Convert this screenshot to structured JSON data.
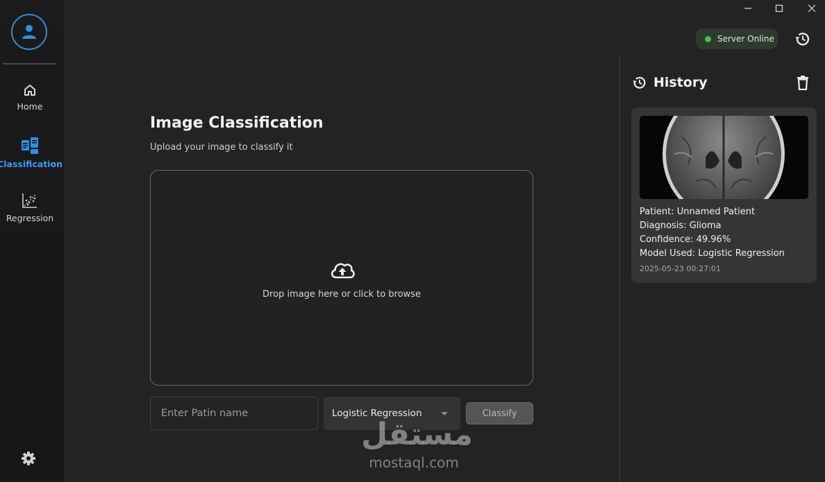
{
  "sidebar": {
    "items": [
      {
        "label": "Home",
        "icon": "home-icon"
      },
      {
        "label": "Classification",
        "icon": "classification-icon"
      },
      {
        "label": "Regression",
        "icon": "regression-icon"
      }
    ],
    "active": "Classification"
  },
  "status": {
    "label": "Server Online",
    "color": "#46c24c"
  },
  "main": {
    "title": "Image Classification",
    "subtitle": "Upload your image to classify it",
    "dropzone_text": "Drop image here or click to browse",
    "name_placeholder": "Enter Patin name",
    "model_selected": "Logistic Regression",
    "classify_label": "Classify"
  },
  "history": {
    "title": "History",
    "entries": [
      {
        "patient": "Patient: Unnamed Patient",
        "diagnosis": "Diagnosis: Glioma",
        "confidence": "Confidence: 49.96%",
        "model": "Model Used: Logistic Regression",
        "timestamp": "2025-05-23 00:27:01"
      }
    ]
  },
  "watermark": {
    "arabic": "مستقل",
    "latin": "mostaql.com"
  },
  "colors": {
    "accent": "#2f8fe6",
    "background": "#232323",
    "sidebar": "#1b1b1b",
    "card": "#353535"
  }
}
